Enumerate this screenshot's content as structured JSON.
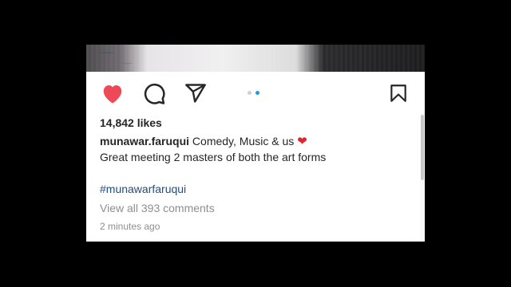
{
  "post": {
    "likes": "14,842 likes",
    "username": "munawar.faruqui",
    "caption_text": " Comedy, Music & us ",
    "caption_emoji": "❤",
    "caption_line2": "Great meeting 2 masters of both the art forms",
    "hashtag": "#munawarfaruqui",
    "view_comments": "View all 393 comments",
    "timestamp": "2 minutes ago"
  },
  "icons": {
    "like": "heart-filled-icon",
    "comment": "comment-bubble-icon",
    "share": "paper-plane-icon",
    "save": "bookmark-icon"
  },
  "carousel": {
    "total": 2,
    "active": 2
  },
  "colors": {
    "like_red": "#ed4956",
    "active_dot": "#2a95e0",
    "hashtag_blue": "#234d7a",
    "muted_gray": "#8e8e8e"
  }
}
